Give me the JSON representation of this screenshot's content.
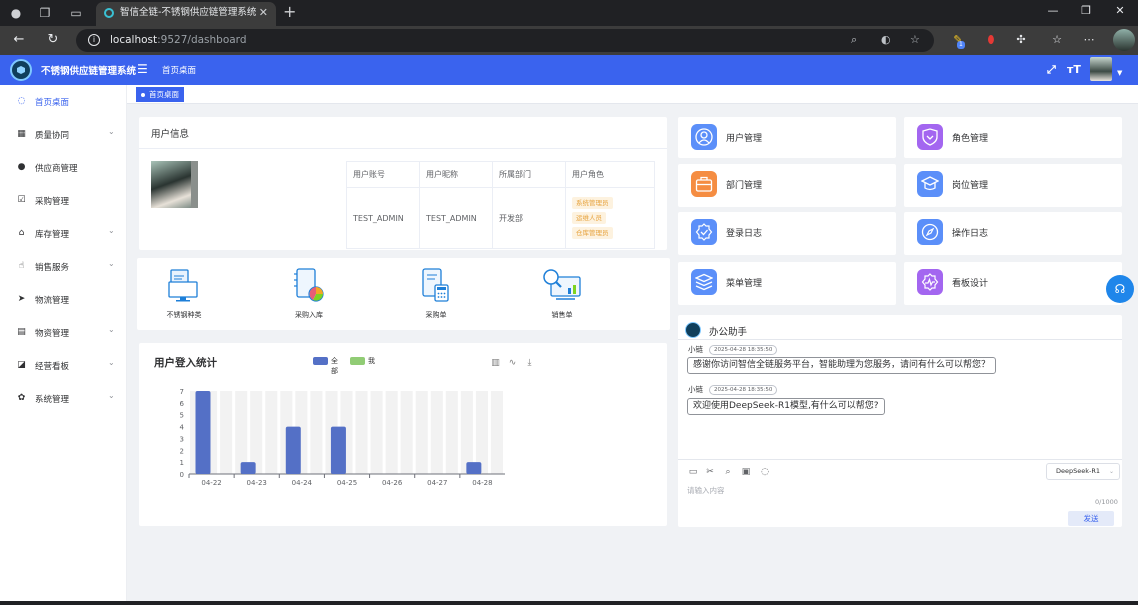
{
  "browser": {
    "tab_title": "智信全链-不锈钢供应链管理系统",
    "url_host": "localhost",
    "url_path": ":9527/dashboard",
    "ext_badge": "1"
  },
  "app": {
    "title": "不锈钢供应链管理系统",
    "breadcrumb": "首页桌面",
    "active_tag": "首页桌面",
    "brand_color": "#3a63ee"
  },
  "sidebar": {
    "items": [
      {
        "label": "首页桌面",
        "icon": "dashboard-icon",
        "active": true,
        "has_arrow": false
      },
      {
        "label": "质量协同",
        "icon": "grid-icon",
        "has_arrow": true
      },
      {
        "label": "供应商管理",
        "icon": "person-icon",
        "has_arrow": false
      },
      {
        "label": "采购管理",
        "icon": "checklist-icon",
        "has_arrow": false
      },
      {
        "label": "库存管理",
        "icon": "home-icon",
        "has_arrow": true
      },
      {
        "label": "销售服务",
        "icon": "hand-icon",
        "has_arrow": true
      },
      {
        "label": "物流管理",
        "icon": "send-icon",
        "has_arrow": false
      },
      {
        "label": "物资管理",
        "icon": "clipboard-icon",
        "has_arrow": true
      },
      {
        "label": "经营看板",
        "icon": "chart-icon",
        "has_arrow": true
      },
      {
        "label": "系统管理",
        "icon": "gear-icon",
        "has_arrow": true
      }
    ]
  },
  "user_info": {
    "title": "用户信息",
    "columns": [
      "用户账号",
      "用户昵称",
      "所属部门",
      "用户角色"
    ],
    "account": "TEST_ADMIN",
    "nickname": "TEST_ADMIN",
    "department": "开发部",
    "roles": [
      "系统管理员",
      "运维人员",
      "仓库管理员"
    ]
  },
  "quick_links": [
    {
      "label": "不锈钢种类",
      "icon": "monitor-doc-icon"
    },
    {
      "label": "采购入库",
      "icon": "notebook-chart-icon"
    },
    {
      "label": "采购单",
      "icon": "calculator-doc-icon"
    },
    {
      "label": "销售单",
      "icon": "search-chart-icon"
    }
  ],
  "chart": {
    "title": "用户登入统计",
    "legend": [
      "全部",
      "我"
    ]
  },
  "chart_data": {
    "type": "bar",
    "title": "用户登入统计",
    "categories": [
      "04-22",
      "04-23",
      "04-24",
      "04-25",
      "04-26",
      "04-27",
      "04-28"
    ],
    "series": [
      {
        "name": "全部",
        "color": "#5470c6",
        "values": [
          7,
          1,
          4,
          4,
          0,
          0,
          1
        ]
      },
      {
        "name": "我",
        "color": "#91cc75",
        "values": [
          0,
          0,
          0,
          0,
          0,
          0,
          0
        ]
      }
    ],
    "ylim": [
      0,
      7
    ],
    "yticks": [
      0,
      1,
      2,
      3,
      4,
      5,
      6,
      7
    ],
    "legend_position": "top",
    "grid": "vertical bands"
  },
  "modules": [
    {
      "label": "用户管理",
      "icon": "user-icon",
      "color": "#5b8ff9"
    },
    {
      "label": "角色管理",
      "icon": "heart-shield-icon",
      "color": "#a366f0"
    },
    {
      "label": "部门管理",
      "icon": "briefcase-icon",
      "color": "#f58d42"
    },
    {
      "label": "岗位管理",
      "icon": "graduation-cap-icon",
      "color": "#5b8ff9"
    },
    {
      "label": "登录日志",
      "icon": "badge-check-icon",
      "color": "#5b8ff9"
    },
    {
      "label": "操作日志",
      "icon": "compass-icon",
      "color": "#5b8ff9"
    },
    {
      "label": "菜单管理",
      "icon": "layers-icon",
      "color": "#5b8ff9"
    },
    {
      "label": "看板设计",
      "icon": "pulse-badge-icon",
      "color": "#a366f0"
    }
  ],
  "assistant": {
    "title": "办公助手",
    "messages": [
      {
        "sender": "小链",
        "time": "2025-04-28 18:35:50",
        "text": "感谢你访问智信全链服务平台，智能助理为您服务，请问有什么可以帮您？"
      },
      {
        "sender": "小链",
        "time": "2025-04-28 18:35:50",
        "text": "欢迎使用DeepSeek-R1模型,有什么可以帮您?"
      }
    ],
    "model": "DeepSeek-R1",
    "input_placeholder": "请输入内容",
    "char_count": "0/1000",
    "send_label": "发送"
  }
}
